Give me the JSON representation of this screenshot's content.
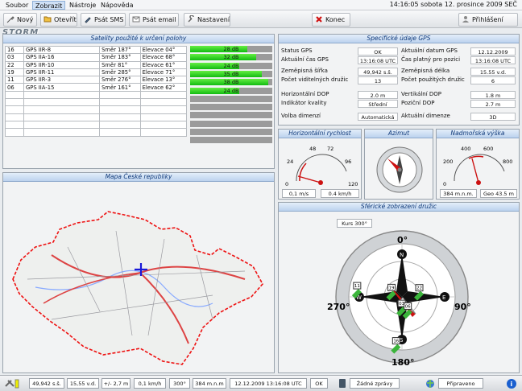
{
  "menu": {
    "items": [
      "Soubor",
      "Zobrazit",
      "Nástroje",
      "Nápověda"
    ],
    "clock": "14:16:05 sobota 12. prosince 2009 SEČ"
  },
  "toolbar": {
    "new": "Nový",
    "open": "Otevřít",
    "sms": "Psát SMS",
    "email": "Psát email",
    "settings": "Nastavení",
    "exit": "Konec",
    "login": "Přihlášení"
  },
  "logo": "STORM ENCOUNTER",
  "satellites": {
    "title": "Satelity použité k určení polohy",
    "rows": [
      {
        "id": "16",
        "name": "GPS IIR-8",
        "dir": "Směr 187°",
        "elev": "Elevace 04°",
        "signal": "28 dB",
        "db": 28
      },
      {
        "id": "03",
        "name": "GPS IIA-16",
        "dir": "Směr 183°",
        "elev": "Elevace 68°",
        "signal": "32 dB",
        "db": 32
      },
      {
        "id": "22",
        "name": "GPS IIR-10",
        "dir": "Směr 81°",
        "elev": "Elevace 61°",
        "signal": "24 dB",
        "db": 24
      },
      {
        "id": "19",
        "name": "GPS IIR-11",
        "dir": "Směr 285°",
        "elev": "Elevace 71°",
        "signal": "35 dB",
        "db": 35
      },
      {
        "id": "11",
        "name": "GPS IIR-3",
        "dir": "Směr 276°",
        "elev": "Elevace 13°",
        "signal": "38 dB",
        "db": 38
      },
      {
        "id": "06",
        "name": "GPS IIA-15",
        "dir": "Směr 161°",
        "elev": "Elevace 62°",
        "signal": "24 dB",
        "db": 24
      }
    ]
  },
  "gps": {
    "title": "Specifické údaje GPS",
    "left": [
      {
        "k": "Status GPS",
        "v": "OK"
      },
      {
        "k": "Aktuální čas GPS",
        "v": "13:16:08 UTC"
      },
      {
        "k": "Zeměpisná šířka",
        "v": "49,942 s.š."
      },
      {
        "k": "Počet viditelných družic",
        "v": "13"
      },
      {
        "k": "Horizontální DOP",
        "v": "2.0 m"
      },
      {
        "k": "Indikátor kvality",
        "v": "Střední"
      },
      {
        "k": "Volba dimenzí",
        "v": "Automatická"
      }
    ],
    "right": [
      {
        "k": "Aktuální datum GPS",
        "v": "12.12.2009"
      },
      {
        "k": "Čas platný pro pozici",
        "v": "13:16:08 UTC"
      },
      {
        "k": "Zeměpisná délka",
        "v": "15.55 v.d."
      },
      {
        "k": "Počet použitých družic",
        "v": "6"
      },
      {
        "k": "Vertikální DOP",
        "v": "1.8 m"
      },
      {
        "k": "Poziční DOP",
        "v": "2.7 m"
      },
      {
        "k": "Aktuální dimenze",
        "v": "3D"
      }
    ]
  },
  "speed": {
    "title": "Horizontální rychlost",
    "ticks": [
      "0",
      "24",
      "48",
      "72",
      "96",
      "120"
    ],
    "ms": "0,1 m/s",
    "kmh": "0.4 km/h"
  },
  "azimut": {
    "title": "Azimut"
  },
  "altitude": {
    "title": "Nadmořská výška",
    "ticks": [
      "0",
      "200",
      "400",
      "600",
      "800"
    ],
    "mnm": "384 m.n.m.",
    "geo": "Geo 43.5 m"
  },
  "map": {
    "title": "Mapa České republiky"
  },
  "sky": {
    "title": "Sférické zobrazení družic",
    "course": "Kurs 300°",
    "e0": "0°",
    "e90": "90°",
    "e180": "180°",
    "e270": "270°",
    "n": "N",
    "e": "E",
    "s": "S",
    "w": "W",
    "sats": [
      "16",
      "03",
      "22",
      "19",
      "11",
      "06"
    ]
  },
  "status": {
    "lat": "49,942 s.š.",
    "lon": "15,55 v.d.",
    "alt_err": "+/- 2,7 m",
    "speed": "0,1 km/h",
    "course": "300°",
    "alt": "384 m.n.m",
    "time": "12.12.2009 13:16:08 UTC",
    "ok": "OK",
    "msgs": "Žádné zprávy",
    "ready": "Připraveno"
  },
  "colors": {
    "accent": "#103a7a",
    "signal": "#22cc22",
    "alert": "#cc1111"
  }
}
